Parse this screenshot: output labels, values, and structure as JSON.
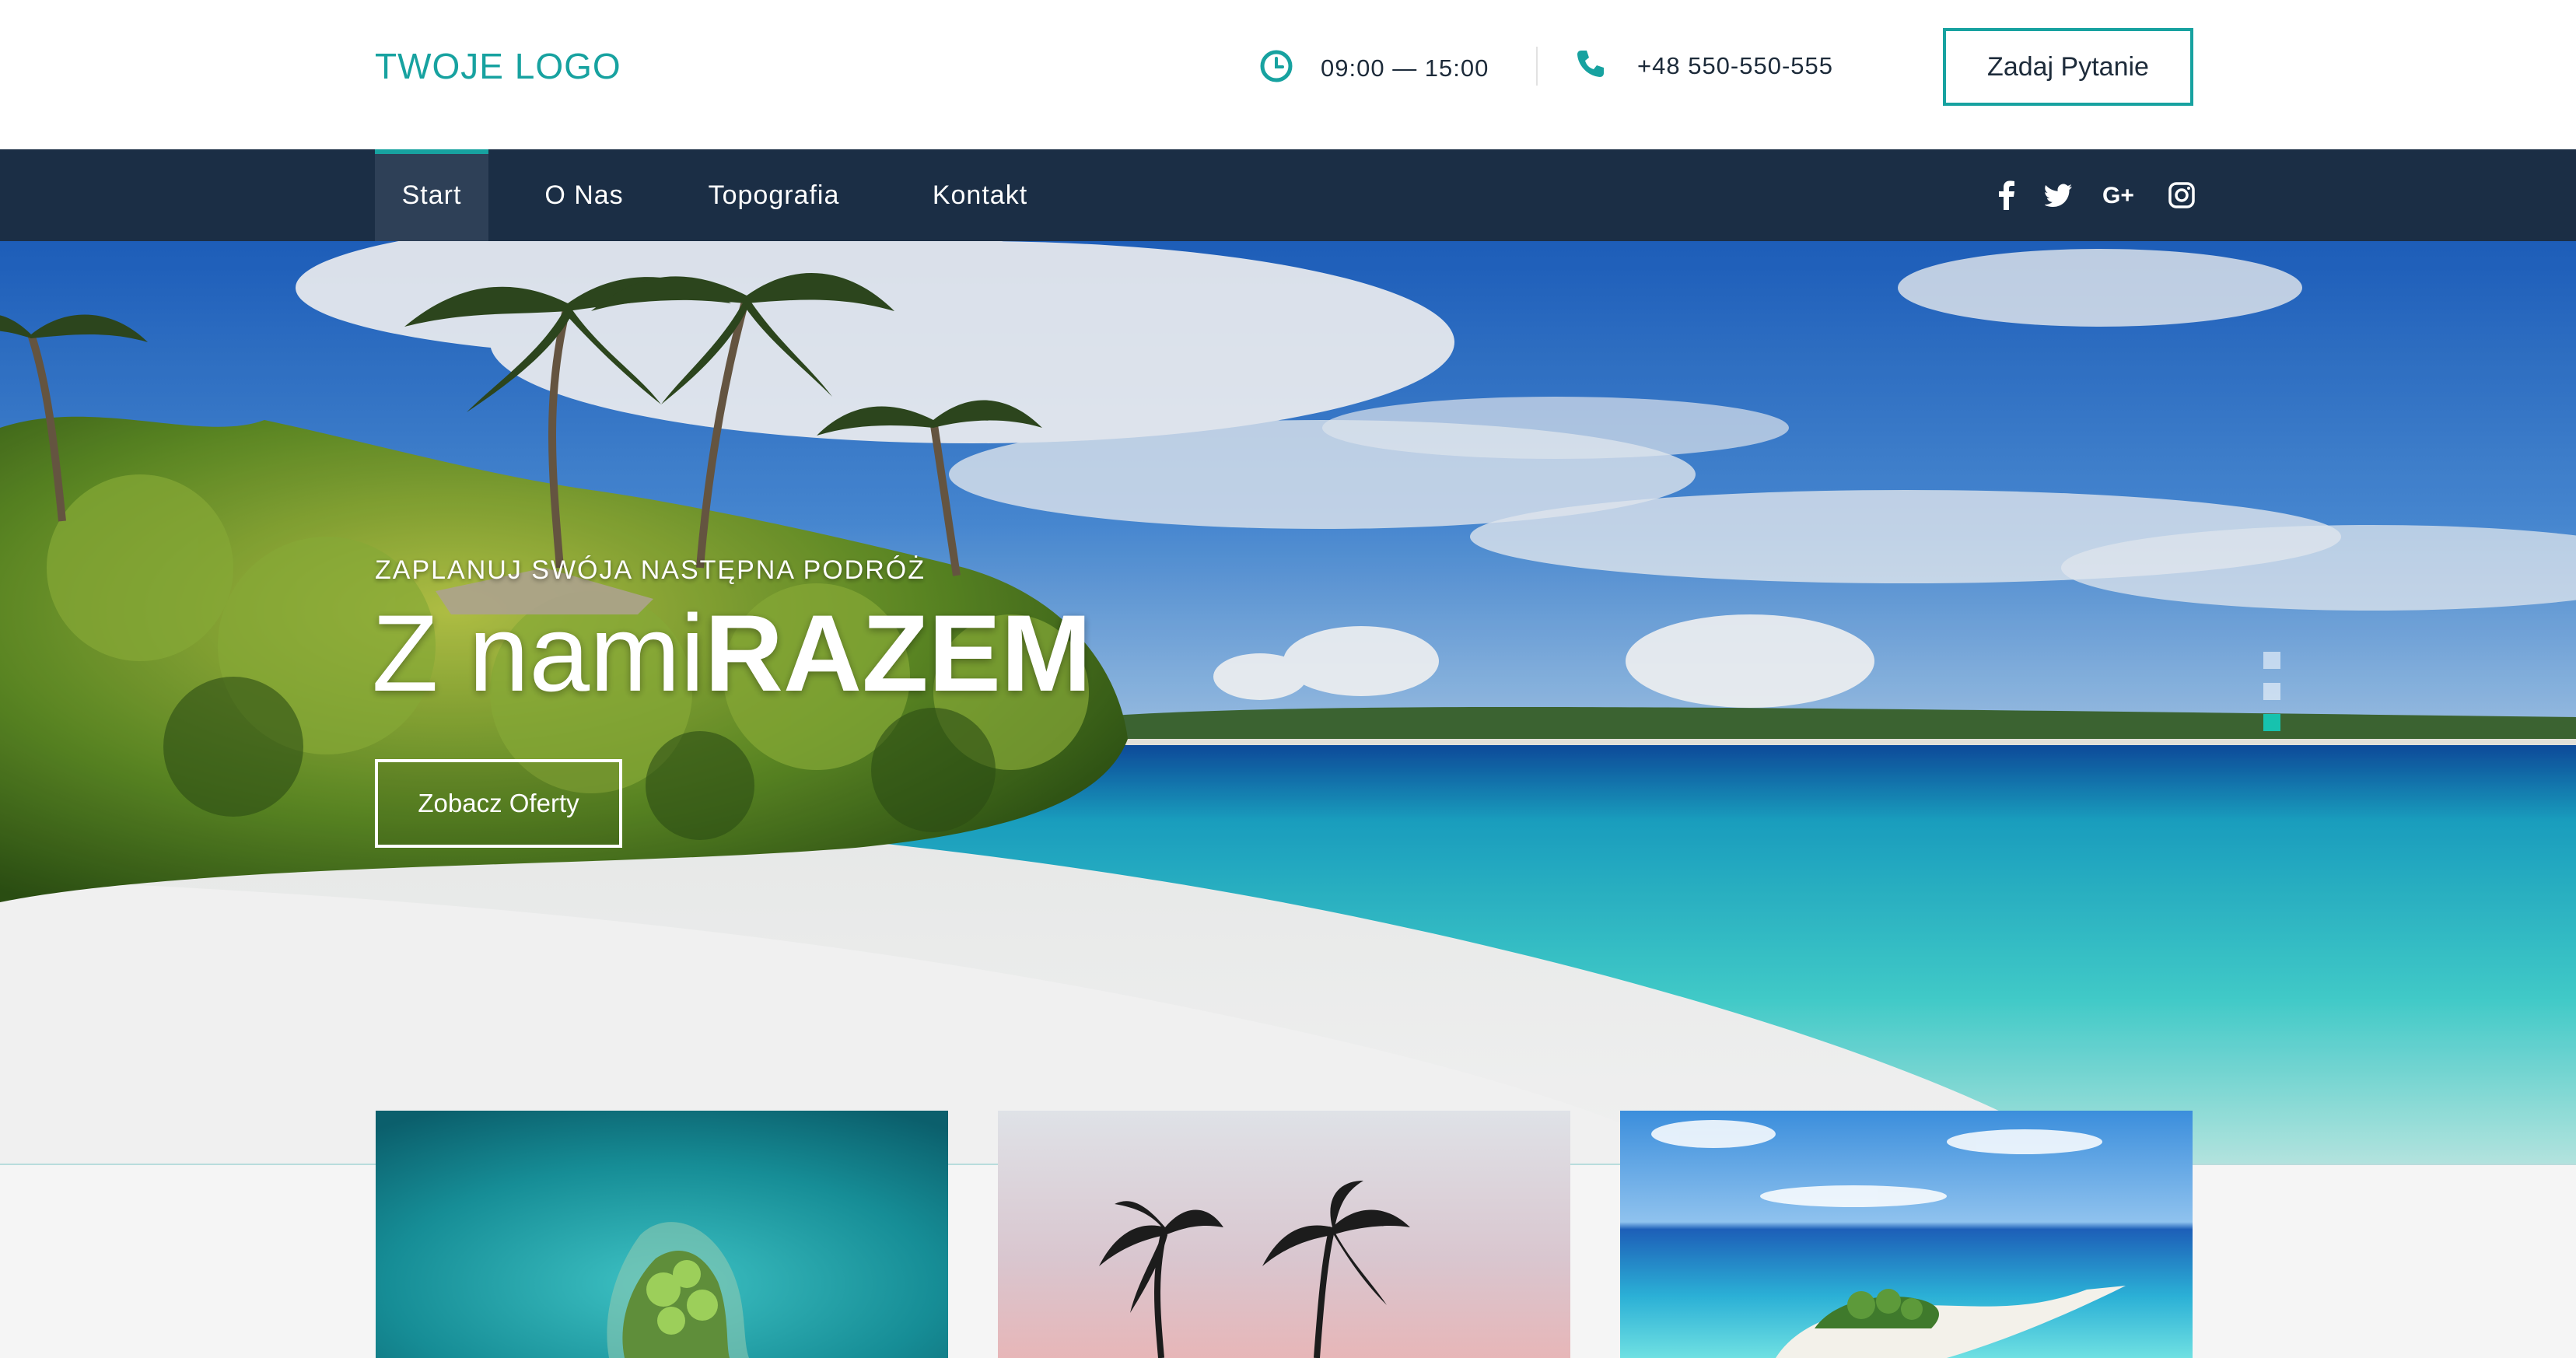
{
  "header": {
    "logo": "TWOJE LOGO",
    "hours": "09:00 — 15:00",
    "phone": "+48 550-550-555",
    "ask_button": "Zadaj Pytanie",
    "icons": {
      "hours": "clock-icon",
      "phone": "phone-icon"
    }
  },
  "nav": {
    "items": [
      {
        "label": "Start",
        "active": true
      },
      {
        "label": "O Nas",
        "active": false
      },
      {
        "label": "Topografia",
        "active": false
      },
      {
        "label": "Kontakt",
        "active": false
      }
    ],
    "social": [
      "facebook-icon",
      "twitter-icon",
      "google-plus-icon",
      "instagram-icon"
    ]
  },
  "hero": {
    "kicker": "ZAPLANUJ SWÓJA NASTĘPNA PODRÓŻ",
    "title_light": "Z nami",
    "title_bold": "RAZEM",
    "button": "Zobacz Oferty",
    "slides": 3,
    "active_slide": 3
  },
  "colors": {
    "accent": "#17a2a0",
    "nav_bg": "#1b2e45",
    "nav_active_bg": "#2e4057",
    "text_dark": "#1d2b3a",
    "section_bg": "#f5f5f5"
  },
  "cards": [
    {
      "image": "aerial-island-photo"
    },
    {
      "image": "palm-trees-sunset-photo"
    },
    {
      "image": "island-sandbar-photo"
    }
  ]
}
